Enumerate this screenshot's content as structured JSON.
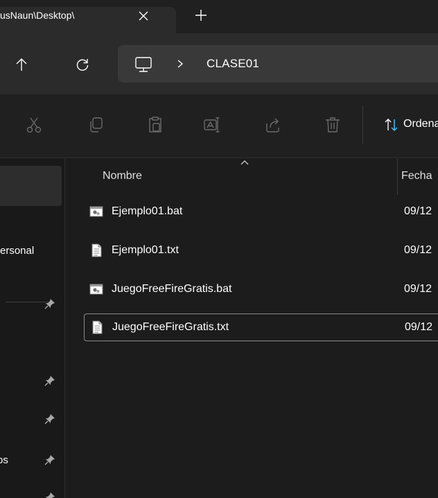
{
  "tab": {
    "title": "usNaun\\Desktop\\",
    "close_glyph": "×",
    "new_tab_glyph": "+"
  },
  "address": {
    "location_icon": "this-pc-icon",
    "crumb": "CLASE01"
  },
  "toolbar": {
    "commands": [
      "cut-icon",
      "copy-icon",
      "paste-icon",
      "rename-icon",
      "share-icon",
      "delete-icon"
    ],
    "sort_label": "Ordenar"
  },
  "nav": {
    "personal_label": "Personal",
    "docs_label": "os"
  },
  "columns": {
    "name": "Nombre",
    "date": "Fecha"
  },
  "files": [
    {
      "name": "Ejemplo01.bat",
      "type": "batch",
      "date": "09/12"
    },
    {
      "name": "Ejemplo01.txt",
      "type": "text",
      "date": "09/12"
    },
    {
      "name": "JuegoFreeFireGratis.bat",
      "type": "batch",
      "date": "09/12"
    },
    {
      "name": "JuegoFreeFireGratis.txt",
      "type": "text",
      "date": "09/12"
    }
  ],
  "colors": {
    "window_bg": "#1c1c1c",
    "address_bg": "#2b2b2b",
    "addressbar_bg": "#393939",
    "focus_border": "#8a8a8a"
  }
}
